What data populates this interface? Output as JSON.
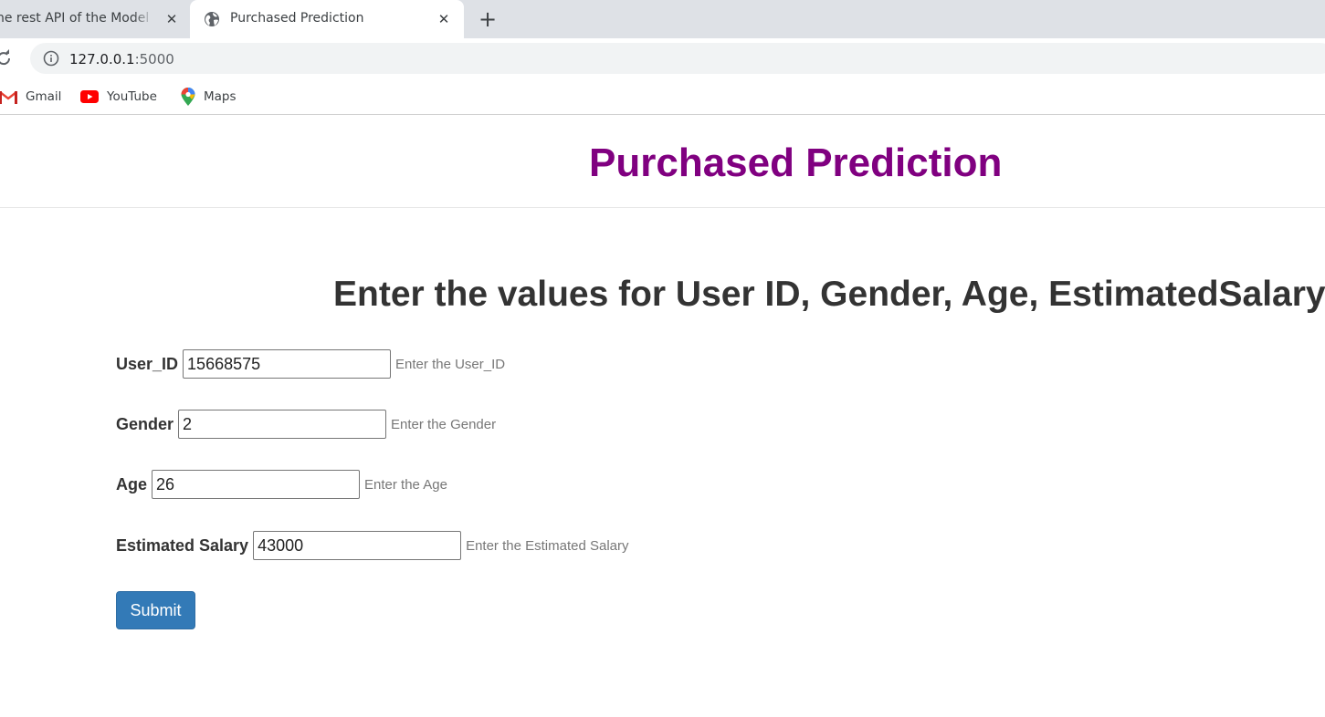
{
  "browser": {
    "tabs": [
      {
        "label": "he rest API of the Model y",
        "active": false
      },
      {
        "label": "Purchased Prediction",
        "active": true
      }
    ],
    "close_glyph": "✕",
    "new_tab_glyph": "+",
    "address": {
      "host": "127.0.0.1",
      "port": ":5000"
    },
    "bookmarks": [
      {
        "label": "Gmail",
        "icon": "gmail-icon"
      },
      {
        "label": "YouTube",
        "icon": "youtube-icon"
      },
      {
        "label": "Maps",
        "icon": "maps-icon"
      }
    ]
  },
  "page": {
    "title": "Purchased Prediction",
    "title_color": "#800080",
    "heading": "Enter the values for User ID, Gender, Age, EstimatedSalary",
    "fields": {
      "user_id": {
        "label": "User_ID",
        "value": "15668575",
        "hint": "Enter the User_ID"
      },
      "gender": {
        "label": "Gender",
        "value": "2",
        "hint": "Enter the Gender"
      },
      "age": {
        "label": "Age",
        "value": "26",
        "hint": "Enter the Age"
      },
      "salary": {
        "label": "Estimated Salary",
        "value": "43000",
        "hint": "Enter the Estimated Salary"
      }
    },
    "submit_label": "Submit",
    "submit_color": "#337ab7"
  }
}
